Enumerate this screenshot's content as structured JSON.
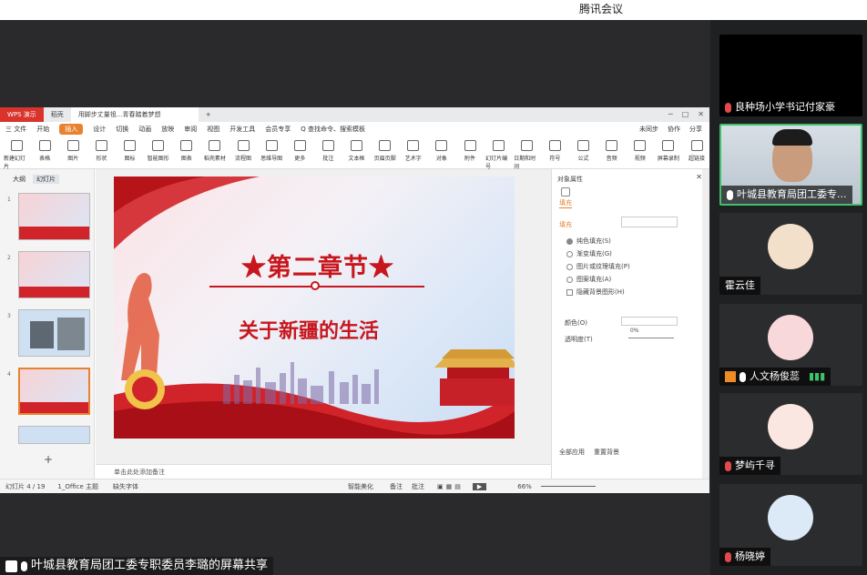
{
  "app_title": "腾讯会议",
  "share_label": "叶城县教育局团工委专职委员李璐的屏幕共享",
  "wps": {
    "tabs": [
      "WPS 演示",
      "稻壳",
      "用脚步丈量祖...青春踏着梦想"
    ],
    "menu": [
      "三 文件",
      "开始",
      "插入",
      "设计",
      "切换",
      "动画",
      "放映",
      "审阅",
      "视图",
      "开发工具",
      "会员专享",
      "Q 查找命令、搜索模板"
    ],
    "menu_active": "插入",
    "menu_right": [
      "未同步",
      "协作",
      "分享"
    ],
    "ribbon": [
      "新建幻灯片",
      "表格",
      "图片",
      "形状",
      "图标",
      "智能图形",
      "图表",
      "稻壳素材",
      "流程图",
      "思维导图",
      "更多",
      "批注",
      "文本框",
      "页眉页脚",
      "艺术字",
      "对象",
      "附件",
      "幻灯片编号",
      "日期和时间",
      "符号",
      "公式",
      "音频",
      "视频",
      "屏幕录制",
      "超链接"
    ],
    "left_tabs": [
      "大纲",
      "幻灯片"
    ],
    "thumbs": [
      "1",
      "2",
      "3",
      "4"
    ],
    "slide_title": "★第二章节★",
    "slide_subtitle": "关于新疆的生活",
    "notes": "单击此处添加备注",
    "pane": {
      "title": "对象属性",
      "tab": "填充",
      "section": "填充",
      "options": [
        "纯色填充(S)",
        "渐变填充(G)",
        "图片或纹理填充(P)",
        "图案填充(A)",
        "隐藏背景图形(H)"
      ],
      "color_label": "颜色(O)",
      "transparency_label": "透明度(T)",
      "transparency_value": "0%",
      "apply_all": "全部应用",
      "reset": "重置背景"
    },
    "status": {
      "slide": "幻灯片 4 / 19",
      "theme": "1_Office 主题",
      "font": "缺失字体",
      "smart": "智能美化",
      "notes": "备注",
      "comment": "批注",
      "zoom": "66%"
    }
  },
  "participants": [
    {
      "name": "良种场小学书记付家豪",
      "mic": "off"
    },
    {
      "name": "叶城县教育局团工委专...",
      "mic": "on"
    },
    {
      "name": "霍云佳",
      "mic": "none"
    },
    {
      "name": "人文杨俊蕊",
      "mic": "on"
    },
    {
      "name": "梦屿千寻",
      "mic": "off"
    },
    {
      "name": "杨晓婷",
      "mic": "off"
    }
  ],
  "colors": {
    "accent": "#e8822f",
    "slide_red": "#c8161d",
    "active_speaker": "#3fc26b"
  }
}
